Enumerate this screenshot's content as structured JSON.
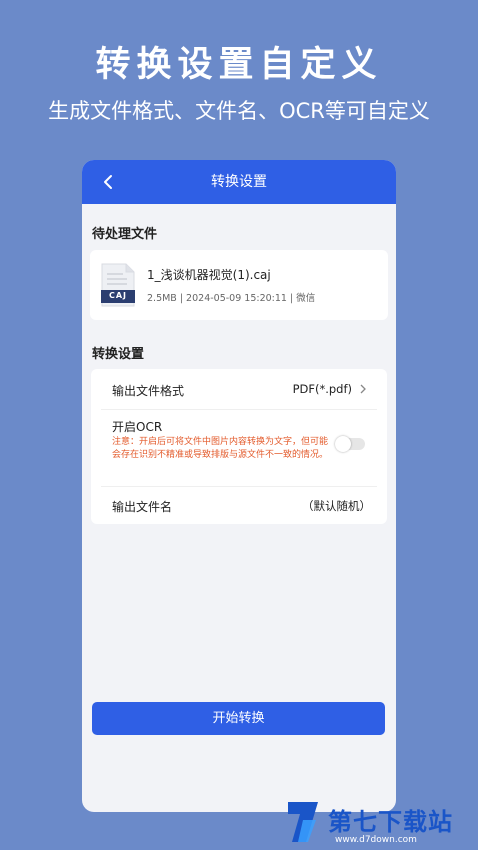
{
  "promo": {
    "title": "转换设置自定义",
    "subtitle": "生成文件格式、文件名、OCR等可自定义"
  },
  "header": {
    "title": "转换设置",
    "back_icon": "chevron-left-icon"
  },
  "pending": {
    "section_title": "待处理文件",
    "file": {
      "icon_label": "CAJ",
      "name": "1_浅谈机器视觉(1).caj",
      "meta": "2.5MB | 2024-05-09 15:20:11 | 微信"
    }
  },
  "settings": {
    "section_title": "转换设置",
    "output_format": {
      "label": "输出文件格式",
      "value": "PDF(*.pdf)"
    },
    "ocr": {
      "label": "开启OCR",
      "note": "注意：开启后可将文件中图片内容转换为文字，但可能会存在识别不精准或导致排版与源文件不一致的情况。",
      "enabled": false
    },
    "output_name": {
      "label": "输出文件名",
      "value": "（默认随机）"
    }
  },
  "actions": {
    "start_label": "开始转换"
  },
  "watermark": {
    "text": "第七下载站",
    "url": "www.d7down.com"
  },
  "colors": {
    "background": "#6b8ac9",
    "accent": "#2f5fe5",
    "warning": "#e35b2c",
    "watermark": "#1a55c8"
  }
}
